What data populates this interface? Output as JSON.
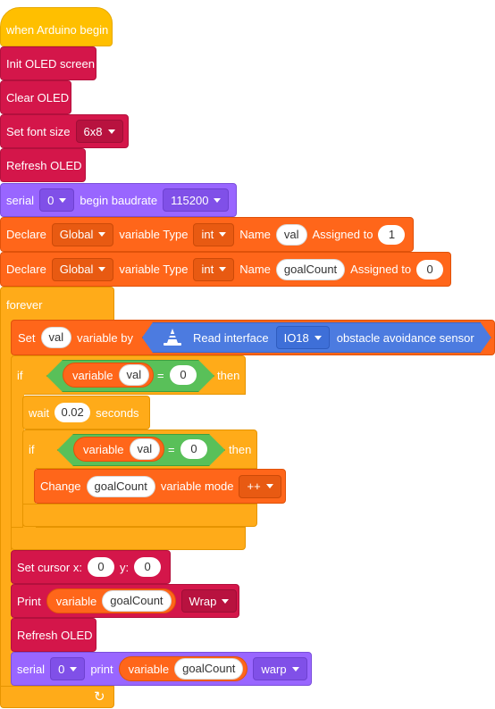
{
  "hat": {
    "label": "when Arduino begin"
  },
  "setup": {
    "init_oled": "Init OLED screen",
    "clear_oled": "Clear OLED",
    "font": {
      "label": "Set font size",
      "value": "6x8"
    },
    "refresh_oled": "Refresh OLED",
    "serial_begin": {
      "label1": "serial",
      "port": "0",
      "label2": "begin baudrate",
      "baud": "115200"
    },
    "declare1": {
      "label": "Declare",
      "scope": "Global",
      "type_label": "variable Type",
      "type": "int",
      "name_label": "Name",
      "name": "val",
      "assign_label": "Assigned to",
      "value": "1"
    },
    "declare2": {
      "label": "Declare",
      "scope": "Global",
      "type_label": "variable Type",
      "type": "int",
      "name_label": "Name",
      "name": "goalCount",
      "assign_label": "Assigned to",
      "value": "0"
    }
  },
  "forever": {
    "label": "forever",
    "set": {
      "label": "Set",
      "var": "val",
      "by": "variable by",
      "read": "Read interface",
      "pin": "IO18",
      "sensor": "obstacle avoidance sensor"
    },
    "if1": {
      "if": "if",
      "variable": "variable",
      "var": "val",
      "op": "=",
      "value": "0",
      "then": "then"
    },
    "wait": {
      "label": "wait",
      "value": "0.02",
      "unit": "seconds"
    },
    "if2": {
      "if": "if",
      "variable": "variable",
      "var": "val",
      "op": "=",
      "value": "0",
      "then": "then"
    },
    "change": {
      "label": "Change",
      "var": "goalCount",
      "mode_label": "variable mode",
      "mode": "++"
    },
    "cursor": {
      "label": "Set cursor x:",
      "x": "0",
      "y_label": "y:",
      "y": "0"
    },
    "print": {
      "label": "Print",
      "variable": "variable",
      "var": "goalCount",
      "mode": "Wrap"
    },
    "refresh": "Refresh OLED",
    "serial_print": {
      "label1": "serial",
      "port": "0",
      "label2": "print",
      "variable": "variable",
      "var": "goalCount",
      "mode": "warp"
    },
    "loop_arrow": "↻"
  },
  "colors": {
    "events": "#FFBF00",
    "control": "#FFAB19",
    "oled": "#D4164A",
    "serial": "#9966FF",
    "variables": "#FF661A",
    "operators": "#59C059",
    "sensor": "#4C7BE0"
  }
}
